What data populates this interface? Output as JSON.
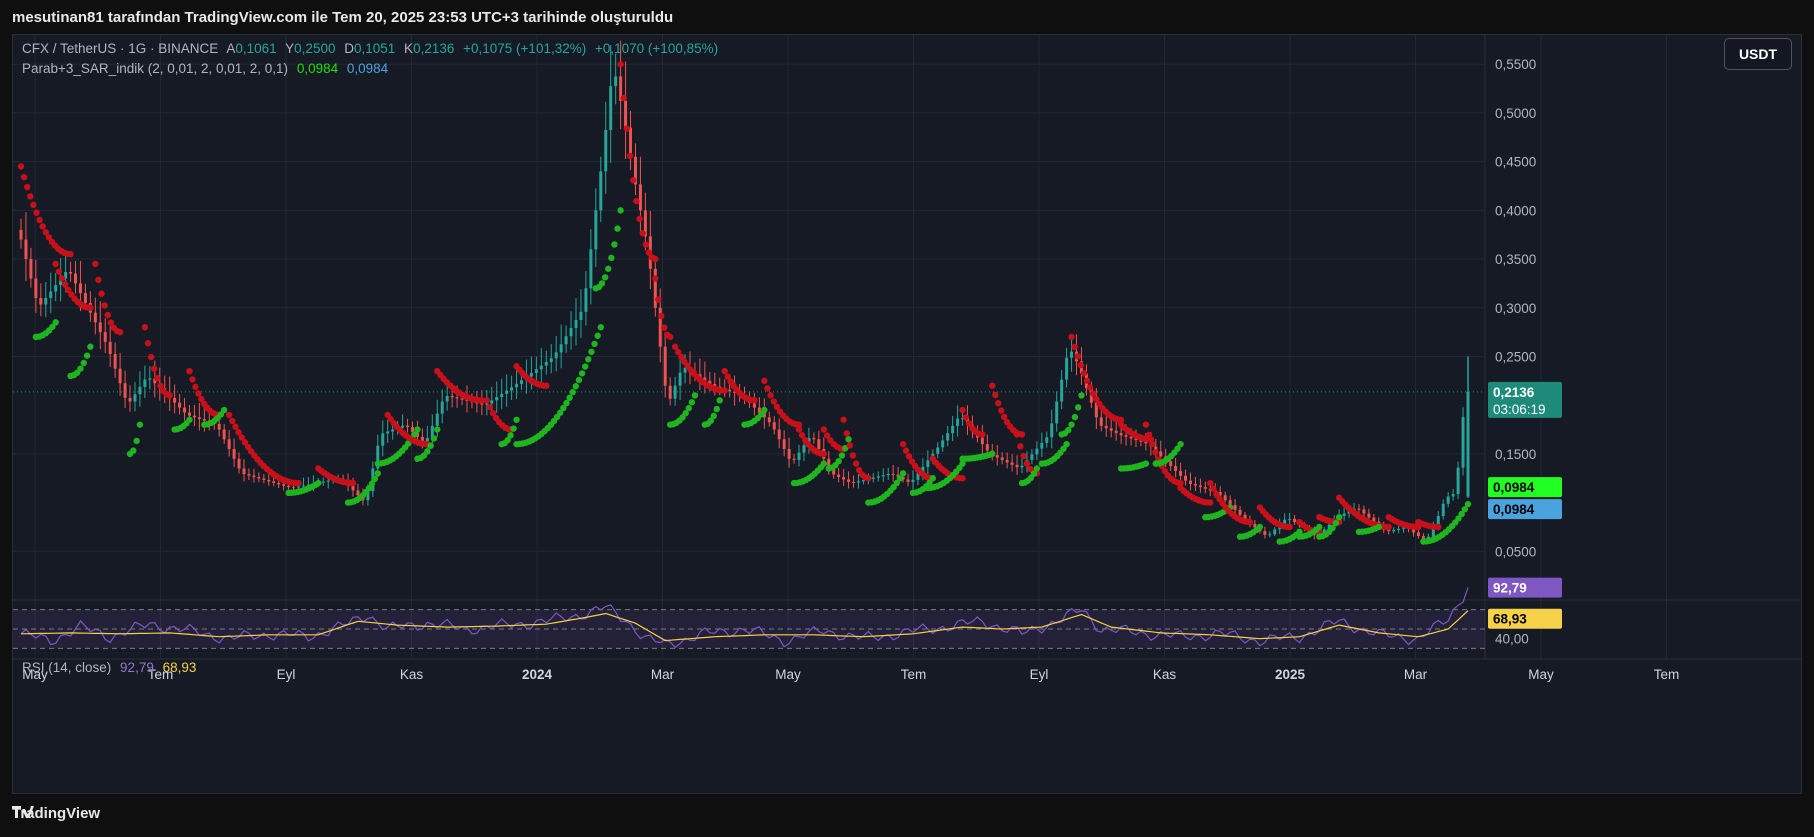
{
  "header": {
    "snapshot_caption": "mesutinan81 tarafından TradingView.com ile Tem 20, 2025 23:53 UTC+3 tarihinde oluşturuldu"
  },
  "legend": {
    "symbol": "CFX / TetherUS · 1G · BINANCE",
    "open_label": "A",
    "open": "0,1061",
    "high_label": "Y",
    "high": "0,2500",
    "low_label": "D",
    "low": "0,1051",
    "close_label": "K",
    "close": "0,2136",
    "change": "+0,1075 (+101,32%)",
    "change2": "+0,1070 (+100,85%)"
  },
  "indicator": {
    "name": "Parab+3_SAR_indik (2, 0,01, 2, 0,01, 2, 0,1)",
    "value1": "0,0984",
    "value2": "0,0984"
  },
  "rsi": {
    "name": "RSI (14, close)",
    "value": "92,79",
    "ma_value": "68,93",
    "level_label": "40,00"
  },
  "currency_button": "USDT",
  "price_tag": {
    "price": "0,2136",
    "countdown": "03:06:19"
  },
  "sar_tag1": "0,0984",
  "sar_tag2": "0,0984",
  "footer": {
    "brand": "TradingView"
  },
  "colors": {
    "up": "#26a69a",
    "down": "#ef5350",
    "sar_up": "#1fb51f",
    "sar_down": "#c8101b",
    "rsi_line": "#7e57c2",
    "rsi_ma": "#f5d14a",
    "price_tag": "#1e8a7a",
    "tag_green": "#22ff22",
    "tag_blue": "#4aa3df"
  },
  "chart_data": {
    "type": "candlestick",
    "y_axis": {
      "ticks": [
        "0,0500",
        "0,1500",
        "0,2500",
        "0,3000",
        "0,3500",
        "0,4000",
        "0,4500",
        "0,5000",
        "0,5500"
      ],
      "range": [
        0.0,
        0.58
      ]
    },
    "x_axis": {
      "ticks": [
        "May",
        "Tem",
        "Eyl",
        "Kas",
        "2024",
        "Mar",
        "May",
        "Tem",
        "Eyl",
        "Kas",
        "2025",
        "Mar",
        "May",
        "Tem"
      ]
    },
    "price_path": [
      [
        0,
        0.38
      ],
      [
        4,
        0.3
      ],
      [
        10,
        0.34
      ],
      [
        18,
        0.26
      ],
      [
        22,
        0.2
      ],
      [
        26,
        0.23
      ],
      [
        34,
        0.19
      ],
      [
        40,
        0.18
      ],
      [
        45,
        0.13
      ],
      [
        55,
        0.115
      ],
      [
        65,
        0.125
      ],
      [
        70,
        0.1
      ],
      [
        73,
        0.17
      ],
      [
        78,
        0.18
      ],
      [
        82,
        0.16
      ],
      [
        86,
        0.21
      ],
      [
        94,
        0.2
      ],
      [
        100,
        0.22
      ],
      [
        108,
        0.25
      ],
      [
        114,
        0.3
      ],
      [
        116,
        0.38
      ],
      [
        118,
        0.46
      ],
      [
        120,
        0.55
      ],
      [
        122,
        0.5
      ],
      [
        124,
        0.44
      ],
      [
        127,
        0.36
      ],
      [
        129,
        0.28
      ],
      [
        131,
        0.2
      ],
      [
        134,
        0.24
      ],
      [
        140,
        0.22
      ],
      [
        146,
        0.21
      ],
      [
        152,
        0.18
      ],
      [
        156,
        0.14
      ],
      [
        160,
        0.17
      ],
      [
        164,
        0.13
      ],
      [
        168,
        0.12
      ],
      [
        176,
        0.13
      ],
      [
        180,
        0.12
      ],
      [
        186,
        0.16
      ],
      [
        190,
        0.19
      ],
      [
        196,
        0.15
      ],
      [
        202,
        0.135
      ],
      [
        208,
        0.17
      ],
      [
        212,
        0.26
      ],
      [
        214,
        0.24
      ],
      [
        218,
        0.18
      ],
      [
        222,
        0.17
      ],
      [
        228,
        0.16
      ],
      [
        232,
        0.14
      ],
      [
        236,
        0.12
      ],
      [
        242,
        0.11
      ],
      [
        248,
        0.08
      ],
      [
        252,
        0.065
      ],
      [
        256,
        0.085
      ],
      [
        262,
        0.065
      ],
      [
        266,
        0.085
      ],
      [
        270,
        0.095
      ],
      [
        276,
        0.07
      ],
      [
        280,
        0.075
      ],
      [
        284,
        0.06
      ],
      [
        286,
        0.08
      ],
      [
        288,
        0.105
      ],
      [
        290,
        0.11
      ],
      [
        292,
        0.2136
      ]
    ],
    "sar_segments": [
      {
        "trend": "down",
        "x": [
          0,
          10
        ],
        "y": [
          0.445,
          0.355
        ]
      },
      {
        "trend": "up",
        "x": [
          3,
          7
        ],
        "y": [
          0.27,
          0.285
        ]
      },
      {
        "trend": "down",
        "x": [
          7,
          14
        ],
        "y": [
          0.345,
          0.3
        ]
      },
      {
        "trend": "up",
        "x": [
          10,
          14
        ],
        "y": [
          0.23,
          0.26
        ]
      },
      {
        "trend": "down",
        "x": [
          15,
          20
        ],
        "y": [
          0.345,
          0.275
        ]
      },
      {
        "trend": "up",
        "x": [
          22,
          24
        ],
        "y": [
          0.15,
          0.18
        ]
      },
      {
        "trend": "down",
        "x": [
          25,
          30
        ],
        "y": [
          0.28,
          0.21
        ]
      },
      {
        "trend": "up",
        "x": [
          31,
          34
        ],
        "y": [
          0.175,
          0.185
        ]
      },
      {
        "trend": "down",
        "x": [
          34,
          40
        ],
        "y": [
          0.235,
          0.19
        ]
      },
      {
        "trend": "up",
        "x": [
          37,
          41
        ],
        "y": [
          0.18,
          0.195
        ]
      },
      {
        "trend": "down",
        "x": [
          42,
          56
        ],
        "y": [
          0.19,
          0.12
        ]
      },
      {
        "trend": "up",
        "x": [
          54,
          60
        ],
        "y": [
          0.11,
          0.12
        ]
      },
      {
        "trend": "down",
        "x": [
          60,
          67
        ],
        "y": [
          0.135,
          0.12
        ]
      },
      {
        "trend": "up",
        "x": [
          66,
          72
        ],
        "y": [
          0.1,
          0.13
        ]
      },
      {
        "trend": "up",
        "x": [
          72,
          80
        ],
        "y": [
          0.14,
          0.175
        ]
      },
      {
        "trend": "down",
        "x": [
          74,
          82
        ],
        "y": [
          0.19,
          0.16
        ]
      },
      {
        "trend": "up",
        "x": [
          80,
          84
        ],
        "y": [
          0.145,
          0.175
        ]
      },
      {
        "trend": "down",
        "x": [
          84,
          93
        ],
        "y": [
          0.235,
          0.205
        ]
      },
      {
        "trend": "down",
        "x": [
          94,
          99
        ],
        "y": [
          0.205,
          0.175
        ]
      },
      {
        "trend": "up",
        "x": [
          97,
          100
        ],
        "y": [
          0.16,
          0.185
        ]
      },
      {
        "trend": "down",
        "x": [
          100,
          106
        ],
        "y": [
          0.24,
          0.22
        ]
      },
      {
        "trend": "up",
        "x": [
          100,
          117
        ],
        "y": [
          0.16,
          0.28
        ]
      },
      {
        "trend": "up",
        "x": [
          116,
          121
        ],
        "y": [
          0.32,
          0.4
        ]
      },
      {
        "trend": "down",
        "x": [
          121,
          128
        ],
        "y": [
          0.55,
          0.35
        ]
      },
      {
        "trend": "down",
        "x": [
          128,
          131
        ],
        "y": [
          0.33,
          0.27
        ]
      },
      {
        "trend": "up",
        "x": [
          131,
          136
        ],
        "y": [
          0.18,
          0.21
        ]
      },
      {
        "trend": "down",
        "x": [
          132,
          142
        ],
        "y": [
          0.26,
          0.215
        ]
      },
      {
        "trend": "up",
        "x": [
          138,
          141
        ],
        "y": [
          0.18,
          0.205
        ]
      },
      {
        "trend": "down",
        "x": [
          142,
          148
        ],
        "y": [
          0.235,
          0.205
        ]
      },
      {
        "trend": "up",
        "x": [
          146,
          150
        ],
        "y": [
          0.18,
          0.195
        ]
      },
      {
        "trend": "down",
        "x": [
          150,
          157
        ],
        "y": [
          0.225,
          0.18
        ]
      },
      {
        "trend": "down",
        "x": [
          157,
          162
        ],
        "y": [
          0.175,
          0.15
        ]
      },
      {
        "trend": "up",
        "x": [
          156,
          162
        ],
        "y": [
          0.12,
          0.14
        ]
      },
      {
        "trend": "down",
        "x": [
          162,
          166
        ],
        "y": [
          0.175,
          0.155
        ]
      },
      {
        "trend": "up",
        "x": [
          163,
          167
        ],
        "y": [
          0.135,
          0.165
        ]
      },
      {
        "trend": "down",
        "x": [
          166,
          171
        ],
        "y": [
          0.185,
          0.125
        ]
      },
      {
        "trend": "up",
        "x": [
          171,
          178
        ],
        "y": [
          0.1,
          0.13
        ]
      },
      {
        "trend": "down",
        "x": [
          178,
          184
        ],
        "y": [
          0.16,
          0.125
        ]
      },
      {
        "trend": "up",
        "x": [
          180,
          184
        ],
        "y": [
          0.11,
          0.125
        ]
      },
      {
        "trend": "down",
        "x": [
          184,
          190
        ],
        "y": [
          0.145,
          0.125
        ]
      },
      {
        "trend": "up",
        "x": [
          183,
          190
        ],
        "y": [
          0.115,
          0.14
        ]
      },
      {
        "trend": "down",
        "x": [
          190,
          194
        ],
        "y": [
          0.195,
          0.17
        ]
      },
      {
        "trend": "up",
        "x": [
          190,
          196
        ],
        "y": [
          0.145,
          0.15
        ]
      },
      {
        "trend": "down",
        "x": [
          196,
          202
        ],
        "y": [
          0.22,
          0.17
        ]
      },
      {
        "trend": "down",
        "x": [
          201,
          205
        ],
        "y": [
          0.17,
          0.13
        ]
      },
      {
        "trend": "up",
        "x": [
          202,
          205
        ],
        "y": [
          0.12,
          0.135
        ]
      },
      {
        "trend": "up",
        "x": [
          206,
          211
        ],
        "y": [
          0.14,
          0.16
        ]
      },
      {
        "trend": "up",
        "x": [
          210,
          214
        ],
        "y": [
          0.17,
          0.21
        ]
      },
      {
        "trend": "down",
        "x": [
          212,
          222
        ],
        "y": [
          0.27,
          0.185
        ]
      },
      {
        "trend": "down",
        "x": [
          222,
          228
        ],
        "y": [
          0.18,
          0.165
        ]
      },
      {
        "trend": "up",
        "x": [
          222,
          227
        ],
        "y": [
          0.135,
          0.14
        ]
      },
      {
        "trend": "down",
        "x": [
          227,
          234
        ],
        "y": [
          0.18,
          0.12
        ]
      },
      {
        "trend": "up",
        "x": [
          229,
          234
        ],
        "y": [
          0.14,
          0.16
        ]
      },
      {
        "trend": "down",
        "x": [
          234,
          240
        ],
        "y": [
          0.115,
          0.1
        ]
      },
      {
        "trend": "up",
        "x": [
          239,
          244
        ],
        "y": [
          0.085,
          0.095
        ]
      },
      {
        "trend": "down",
        "x": [
          240,
          248
        ],
        "y": [
          0.12,
          0.08
        ]
      },
      {
        "trend": "up",
        "x": [
          246,
          250
        ],
        "y": [
          0.065,
          0.075
        ]
      },
      {
        "trend": "down",
        "x": [
          250,
          256
        ],
        "y": [
          0.095,
          0.075
        ]
      },
      {
        "trend": "up",
        "x": [
          254,
          258
        ],
        "y": [
          0.06,
          0.07
        ]
      },
      {
        "trend": "down",
        "x": [
          258,
          262
        ],
        "y": [
          0.08,
          0.07
        ]
      },
      {
        "trend": "up",
        "x": [
          258,
          262
        ],
        "y": [
          0.065,
          0.075
        ]
      },
      {
        "trend": "down",
        "x": [
          262,
          266
        ],
        "y": [
          0.085,
          0.08
        ]
      },
      {
        "trend": "up",
        "x": [
          262,
          266
        ],
        "y": [
          0.065,
          0.085
        ]
      },
      {
        "trend": "down",
        "x": [
          266,
          276
        ],
        "y": [
          0.105,
          0.075
        ]
      },
      {
        "trend": "up",
        "x": [
          270,
          274
        ],
        "y": [
          0.07,
          0.075
        ]
      },
      {
        "trend": "down",
        "x": [
          276,
          282
        ],
        "y": [
          0.085,
          0.075
        ]
      },
      {
        "trend": "up",
        "x": [
          283,
          292
        ],
        "y": [
          0.06,
          0.0984
        ]
      },
      {
        "trend": "down",
        "x": [
          282,
          286
        ],
        "y": [
          0.08,
          0.075
        ]
      }
    ],
    "rsi_series": {
      "range": [
        20,
        80
      ],
      "levels": [
        30,
        50,
        70
      ],
      "path": [
        [
          0,
          45
        ],
        [
          6,
          38
        ],
        [
          12,
          52
        ],
        [
          18,
          42
        ],
        [
          26,
          55
        ],
        [
          34,
          48
        ],
        [
          42,
          40
        ],
        [
          50,
          45
        ],
        [
          58,
          42
        ],
        [
          66,
          55
        ],
        [
          70,
          65
        ],
        [
          74,
          50
        ],
        [
          82,
          56
        ],
        [
          90,
          50
        ],
        [
          98,
          54
        ],
        [
          106,
          58
        ],
        [
          114,
          66
        ],
        [
          118,
          72
        ],
        [
          122,
          60
        ],
        [
          126,
          40
        ],
        [
          130,
          34
        ],
        [
          138,
          45
        ],
        [
          146,
          50
        ],
        [
          154,
          38
        ],
        [
          162,
          48
        ],
        [
          170,
          40
        ],
        [
          178,
          46
        ],
        [
          186,
          52
        ],
        [
          194,
          58
        ],
        [
          202,
          45
        ],
        [
          210,
          60
        ],
        [
          214,
          70
        ],
        [
          218,
          50
        ],
        [
          226,
          46
        ],
        [
          234,
          42
        ],
        [
          242,
          45
        ],
        [
          250,
          38
        ],
        [
          258,
          42
        ],
        [
          266,
          58
        ],
        [
          274,
          44
        ],
        [
          282,
          40
        ],
        [
          288,
          60
        ],
        [
          292,
          92.79
        ]
      ],
      "ma_path": [
        [
          0,
          45
        ],
        [
          10,
          46
        ],
        [
          20,
          45
        ],
        [
          30,
          46
        ],
        [
          40,
          42
        ],
        [
          50,
          44
        ],
        [
          60,
          44
        ],
        [
          68,
          58
        ],
        [
          76,
          54
        ],
        [
          86,
          52
        ],
        [
          96,
          53
        ],
        [
          106,
          55
        ],
        [
          114,
          62
        ],
        [
          118,
          66
        ],
        [
          124,
          56
        ],
        [
          130,
          38
        ],
        [
          140,
          42
        ],
        [
          150,
          44
        ],
        [
          160,
          44
        ],
        [
          170,
          42
        ],
        [
          180,
          45
        ],
        [
          190,
          52
        ],
        [
          198,
          50
        ],
        [
          206,
          52
        ],
        [
          214,
          65
        ],
        [
          220,
          52
        ],
        [
          230,
          46
        ],
        [
          240,
          44
        ],
        [
          250,
          40
        ],
        [
          258,
          42
        ],
        [
          266,
          54
        ],
        [
          274,
          46
        ],
        [
          282,
          42
        ],
        [
          288,
          50
        ],
        [
          292,
          68.93
        ]
      ]
    }
  }
}
